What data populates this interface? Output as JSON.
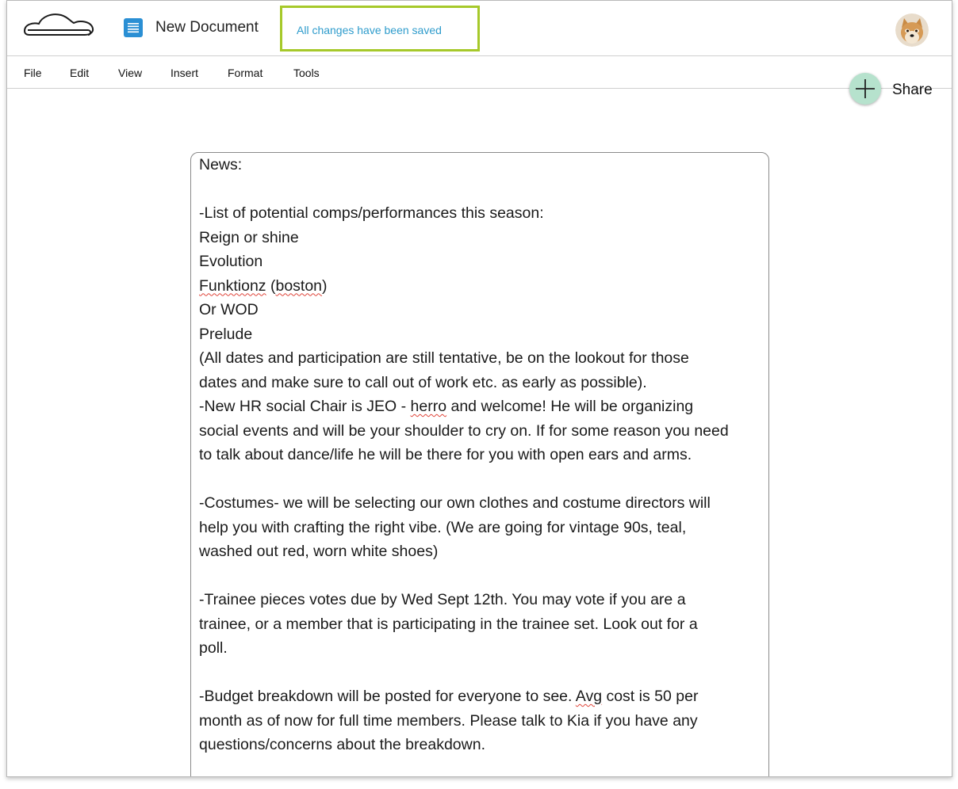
{
  "header": {
    "document_title": "New Document",
    "save_status": "All changes have been saved",
    "logo_icon": "cloud-logo-icon",
    "doc_icon": "document-icon",
    "doc_icon_color": "#2a8fd4",
    "save_status_border_color": "#a6c92a",
    "save_status_text_color": "#2f9ccc"
  },
  "menu": {
    "file": "File",
    "edit": "Edit",
    "view": "View",
    "insert": "Insert",
    "format": "Format",
    "tools": "Tools"
  },
  "share": {
    "label": "Share",
    "icon": "plus-icon",
    "circle_color": "#b6e2cd"
  },
  "user": {
    "avatar_icon": "shiba-dog-avatar"
  },
  "document": {
    "lines": [
      "News:",
      "",
      "-List of potential comps/performances this season:",
      "Reign or shine",
      "Evolution",
      "Funktionz (boston)",
      "Or WOD",
      "Prelude",
      "(All dates and participation are still tentative, be on the lookout for those",
      "dates and make sure to call out of work etc. as early as possible).",
      "-New HR social Chair is JEO - herro and welcome! He will be organizing",
      "social events and will be your shoulder to cry on. If for some reason you need",
      "to talk about dance/life he will be there for you with open ears and arms.",
      "",
      "-Costumes- we will be selecting our own clothes and costume directors will",
      "help you with crafting the right vibe. (We are going for vintage 90s, teal,",
      "washed out red, worn white shoes)",
      "",
      "-Trainee pieces votes due by Wed Sept 12th. You may vote if you are a",
      "trainee, or a member that is participating in the trainee set. Look out for a",
      "poll.",
      "",
      "-Budget breakdown will be posted for everyone to see. Avg cost is 50 per",
      "month as of now for full time members. Please talk to Kia if you have any",
      "questions/concerns about the breakdown."
    ],
    "misspelled_words": [
      "Funktionz",
      "boston",
      "herro",
      "Avg"
    ]
  }
}
